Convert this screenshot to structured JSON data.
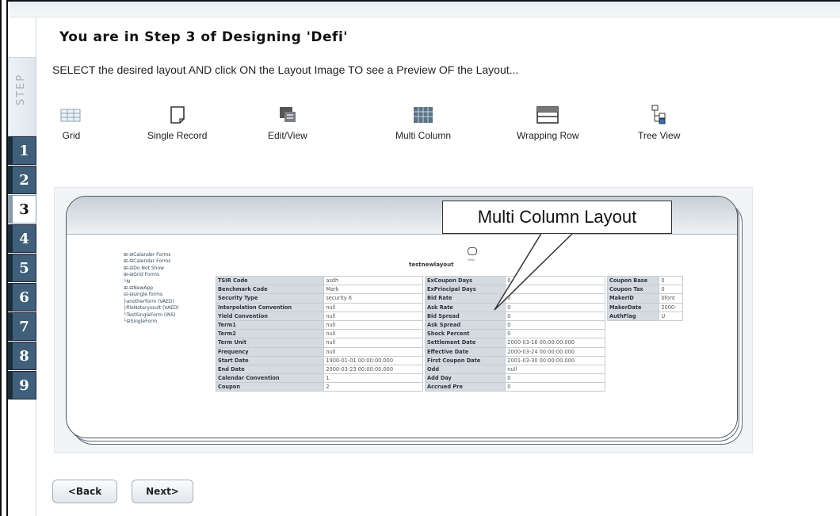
{
  "wizard": {
    "title": "You are in Step 3 of Designing 'Defi'",
    "instruction": "SELECT the desired layout AND click ON the Layout Image TO see a Preview OF the Layout...",
    "step_label": "STEP",
    "steps": [
      "1",
      "2",
      "3",
      "4",
      "5",
      "6",
      "7",
      "8",
      "9"
    ],
    "active_step": "3"
  },
  "layouts": [
    {
      "label": "Grid",
      "icon": "grid-icon"
    },
    {
      "label": "Single Record",
      "icon": "single-record-icon"
    },
    {
      "label": "Edit/View",
      "icon": "edit-view-icon"
    },
    {
      "label": "Multi Column",
      "icon": "multi-column-icon"
    },
    {
      "label": "Wrapping Row",
      "icon": "wrapping-row-icon"
    },
    {
      "label": "Tree View",
      "icon": "tree-view-icon"
    }
  ],
  "preview": {
    "callout": "Multi Column Layout",
    "form_title": "testnewlayout",
    "form_icon_label": "View",
    "tree": [
      "⊞-⊟Calander Forms",
      "⊞-⊟Calendar Forms",
      "⊞-⊟Do Not Show",
      "⊞-⊟Grid Forms",
      "   └N",
      "⊞-⊟NewApp",
      "⊟-⊟single forms",
      "    ├anotherform (VAED)",
      "    ├fileNotaryssult (VAED)",
      "    └TestSingleForm (INS)",
      "  └⊟SingleForm"
    ],
    "col1": [
      [
        "TSIR Code",
        "asdh"
      ],
      [
        "Benchmark Code",
        "Mark"
      ],
      [
        "Security Type",
        "security 6"
      ],
      [
        "Interpolation Convention",
        "null"
      ],
      [
        "Yield Convention",
        "null"
      ],
      [
        "Term1",
        "null"
      ],
      [
        "Term2",
        "null"
      ],
      [
        "Term Unit",
        "null"
      ],
      [
        "Frequency",
        "null"
      ],
      [
        "Start Date",
        "1900-01-01 00:00:00.000"
      ],
      [
        "End Date",
        "2000-03-23 00:00:00.000"
      ],
      [
        "Calendar Convention",
        "1"
      ],
      [
        "Coupon",
        "2"
      ]
    ],
    "col2": [
      [
        "ExCoupon Days",
        "0"
      ],
      [
        "ExPrincipal Days",
        ""
      ],
      [
        "Bid Rate",
        "0"
      ],
      [
        "Ask Rate",
        "0"
      ],
      [
        "Bid Spread",
        "0"
      ],
      [
        "Ask Spread",
        "0"
      ],
      [
        "Shock Percent",
        "0"
      ],
      [
        "Settlement Date",
        "2000-03-16 00:00:00.000"
      ],
      [
        "Effective Date",
        "2000-03-24 00:00:00.000"
      ],
      [
        "First Coupon Date",
        "2001-03-30 00:00:00.000"
      ],
      [
        "Odd",
        "null"
      ],
      [
        "Add Day",
        "0"
      ],
      [
        "Accrued Pre",
        "0"
      ]
    ],
    "col3": [
      [
        "Coupon Base",
        "0"
      ],
      [
        "Coupon Tax",
        "0"
      ],
      [
        "MakerID",
        "bfont"
      ],
      [
        "MakerDate",
        "2000-"
      ],
      [
        "AuthFlag",
        "U"
      ]
    ]
  },
  "nav": {
    "back_label": "<Back",
    "next_label": "Next>"
  }
}
